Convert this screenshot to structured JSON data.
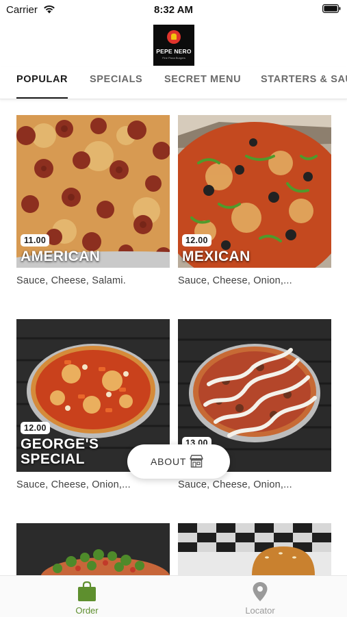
{
  "status_bar": {
    "carrier": "Carrier",
    "time": "8:32 AM"
  },
  "brand": {
    "name": "PEPE NERO",
    "tagline": "Fine Pizza Burgers"
  },
  "tabs": [
    {
      "label": "POPULAR",
      "active": true
    },
    {
      "label": "SPECIALS",
      "active": false
    },
    {
      "label": "SECRET MENU",
      "active": false
    },
    {
      "label": "STARTERS & SAUCES",
      "active": false
    }
  ],
  "products": [
    {
      "name_line1": "AMERICAN",
      "name_line2": "",
      "price": "11.00",
      "description": "Sauce, Cheese, Salami."
    },
    {
      "name_line1": "MEXICAN",
      "name_line2": "",
      "price": "12.00",
      "description": "Sauce, Cheese, Onion,..."
    },
    {
      "name_line1": "GEORGE'S",
      "name_line2": "SPECIAL",
      "price": "12.00",
      "description": "Sauce, Cheese, Onion,..."
    },
    {
      "name_line1": "",
      "name_line2": "",
      "price": "13.00",
      "description": "Sauce, Cheese, Onion,..."
    }
  ],
  "about_button": {
    "label": "ABOUT",
    "icon": "store-icon"
  },
  "bottom_nav": [
    {
      "label": "Order",
      "icon": "shopping-bag-icon",
      "active": true
    },
    {
      "label": "Locator",
      "icon": "location-pin-icon",
      "active": false
    }
  ],
  "colors": {
    "accent": "#5e8f2e",
    "inactive": "#9a9a9a",
    "text": "#1a1a1a"
  }
}
